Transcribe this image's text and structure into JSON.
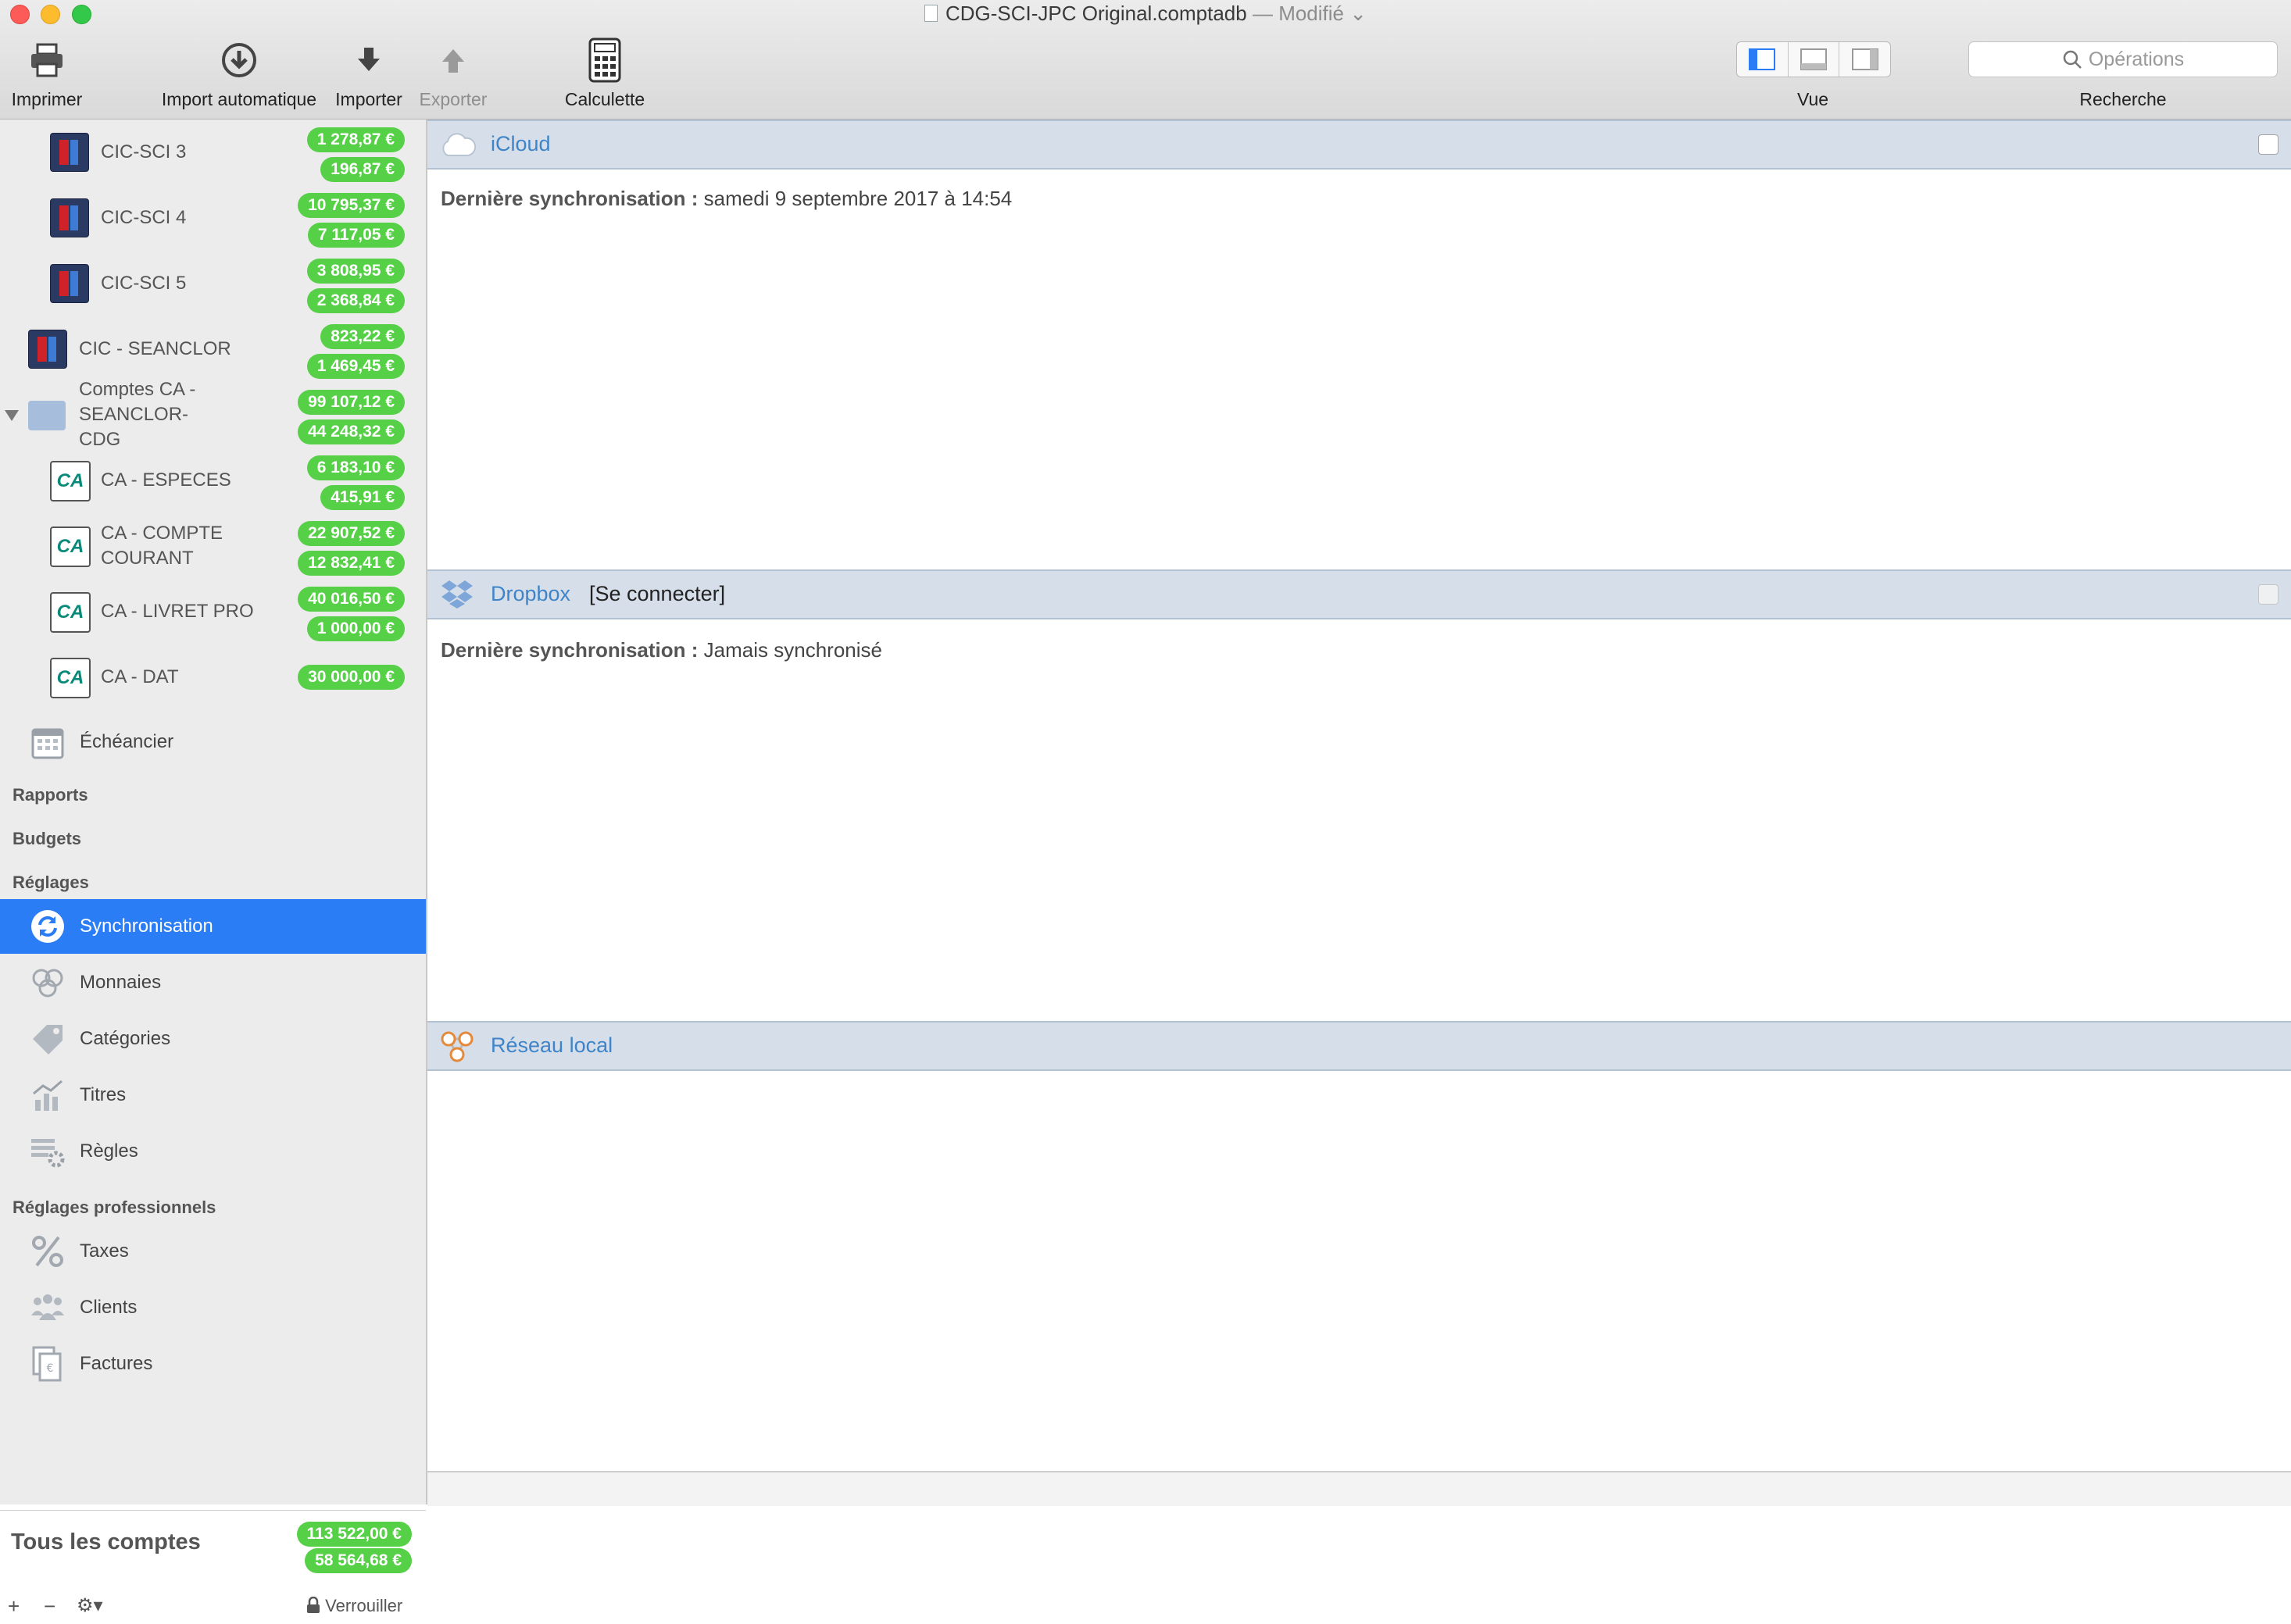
{
  "window": {
    "title": "CDG-SCI-JPC Original.comptadb",
    "modified": "— Modifié"
  },
  "toolbar": {
    "print": "Imprimer",
    "auto_import": "Import automatique",
    "import": "Importer",
    "export": "Exporter",
    "calculator": "Calculette",
    "view_label": "Vue",
    "search_label": "Recherche",
    "search_placeholder": "Opérations"
  },
  "sidebar": {
    "accounts": [
      {
        "name": "CIC-SCI 3",
        "balance": "1 278,87 €",
        "second": "196,87 €",
        "icon": "cic-bank-icon"
      },
      {
        "name": "CIC-SCI 4",
        "balance": "10 795,37 €",
        "second": "7 117,05 €",
        "icon": "cic-bank-icon"
      },
      {
        "name": "CIC-SCI 5",
        "balance": "3 808,95 €",
        "second": "2 368,84 €",
        "icon": "cic-bank-icon"
      },
      {
        "name": "CIC - SEANCLOR",
        "balance": "823,22 €",
        "second": "1 469,45 €",
        "icon": "cic-bank-icon"
      },
      {
        "name": "Comptes CA - SEANCLOR-CDG",
        "balance": "99 107,12 €",
        "second": "44 248,32 €",
        "icon": "folder-icon"
      },
      {
        "name": "CA - ESPECES",
        "balance": "6 183,10 €",
        "second": "415,91 €",
        "icon": "credit-agricole-icon"
      },
      {
        "name": "CA - COMPTE COURANT",
        "balance": "22 907,52 €",
        "second": "12 832,41 €",
        "icon": "credit-agricole-icon"
      },
      {
        "name": "CA - LIVRET PRO",
        "balance": "40 016,50 €",
        "second": "1 000,00 €",
        "icon": "credit-agricole-icon"
      },
      {
        "name": "CA - DAT",
        "balance": "30 000,00 €",
        "icon": "credit-agricole-icon"
      }
    ],
    "scheduler": "Échéancier",
    "reports": "Rapports",
    "budgets": "Budgets",
    "settings_header": "Réglages",
    "settings": {
      "sync": "Synchronisation",
      "currencies": "Monnaies",
      "categories": "Catégories",
      "securities": "Titres",
      "rules": "Règles"
    },
    "pro_settings_header": "Réglages professionnels",
    "pro_settings": {
      "taxes": "Taxes",
      "clients": "Clients",
      "invoices": "Factures"
    },
    "total": {
      "label": "Tous les comptes",
      "balance": "113 522,00 €",
      "second": "58 564,68 €"
    },
    "footer": {
      "add": "+",
      "remove": "−",
      "lock": "Verrouiller"
    }
  },
  "main": {
    "icloud": {
      "title": "iCloud",
      "last_sync_label": "Dernière synchronisation :",
      "last_sync_value": "samedi 9 septembre 2017 à 14:54"
    },
    "dropbox": {
      "title": "Dropbox",
      "connect": "[Se connecter]",
      "last_sync_label": "Dernière synchronisation :",
      "last_sync_value": "Jamais synchronisé"
    },
    "local": {
      "title": "Réseau local"
    }
  },
  "colors": {
    "badge": "#56d046",
    "selection": "#2b7df6",
    "section_header": "#d6dfe9",
    "link": "#3f84c9"
  }
}
